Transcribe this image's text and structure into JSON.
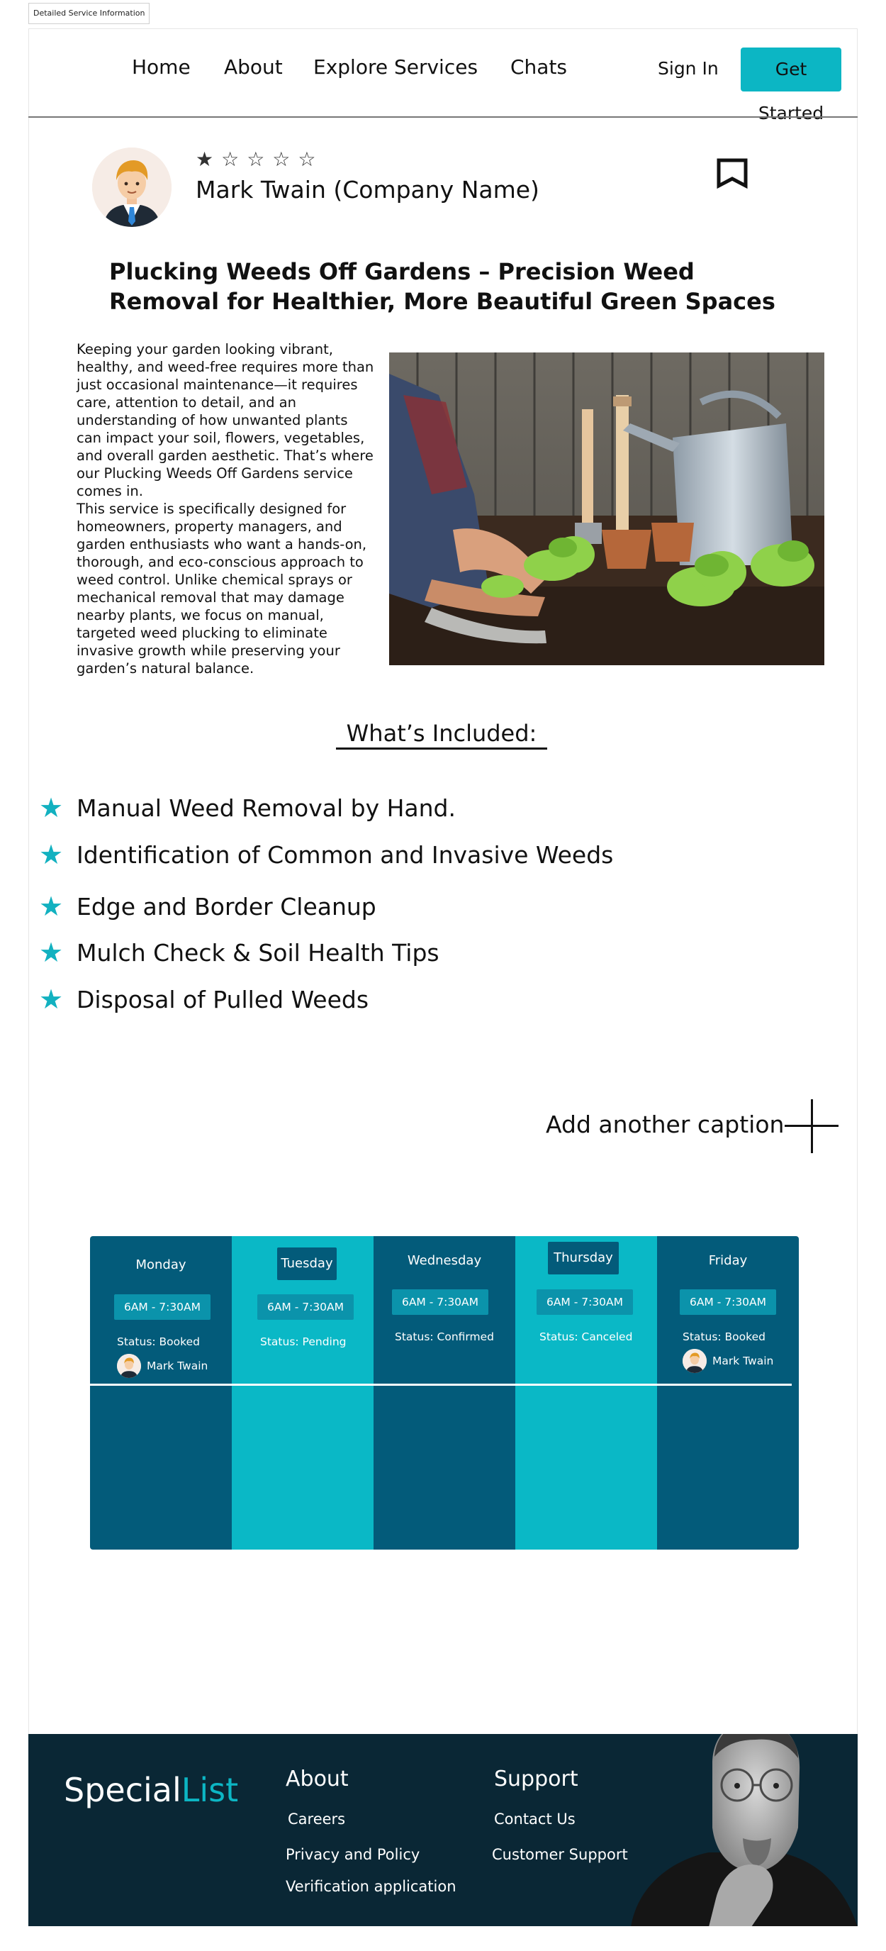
{
  "frame_tag": "Detailed Service Information",
  "nav": {
    "links": [
      "Home",
      "About",
      "Explore Services",
      "Chats"
    ],
    "sign_in": "Sign In",
    "get_started": "Get Started"
  },
  "profile": {
    "stars": "☆☆☆☆☆",
    "rating": 1,
    "rating_max": 5,
    "company": "Mark Twain (Company Name)"
  },
  "service": {
    "title": "Plucking Weeds Off Gardens – Precision Weed Removal for Healthier, More Beautiful Green Spaces",
    "paragraphs": [
      "Keeping your garden looking vibrant, healthy, and weed-free requires more than just occasional maintenance—it requires care, attention to detail, and an understanding of how unwanted plants can impact your soil, flowers, vegetables, and overall garden aesthetic. That’s where our Plucking Weeds Off Gardens service comes in.",
      "This service is specifically designed for homeowners, property managers, and garden enthusiasts who want a hands-on, thorough, and eco-conscious approach to weed control. Unlike chemical sprays or mechanical removal that may damage nearby plants, we focus on manual, targeted weed plucking to eliminate invasive growth while preserving your garden’s natural balance."
    ]
  },
  "included": {
    "title": "What’s Included:",
    "items": [
      "Manual Weed Removal by Hand.",
      "Identification of Common and Invasive Weeds",
      "Edge and Border Cleanup",
      "Mulch Check & Soil Health Tips",
      "Disposal of Pulled Weeds"
    ]
  },
  "caption": "Add another caption",
  "schedule": {
    "days": [
      {
        "day": "Monday",
        "slot": "6AM - 7:30AM",
        "status": "Status: Booked",
        "person": "Mark Twain"
      },
      {
        "day": "Tuesday",
        "slot": "6AM - 7:30AM",
        "status": "Status: Pending"
      },
      {
        "day": "Wednesday",
        "slot": "6AM - 7:30AM",
        "status": "Status: Confirmed"
      },
      {
        "day": "Thursday",
        "slot": "6AM - 7:30AM",
        "status": "Status: Canceled"
      },
      {
        "day": "Friday",
        "slot": "6AM - 7:30AM",
        "status": "Status: Booked",
        "person": "Mark Twain"
      }
    ]
  },
  "footer": {
    "logo_main": "Special",
    "logo_accent": "List",
    "about": {
      "heading": "About",
      "links": [
        "Careers",
        "Privacy and Policy",
        "Verification application"
      ]
    },
    "support": {
      "heading": "Support",
      "links": [
        "Contact Us",
        "Customer Support"
      ]
    }
  },
  "colors": {
    "accent": "#0cb6c4",
    "schedule_dark": "#035b7a",
    "schedule_light": "#0ab8c6",
    "footer_bg": "#0a2735"
  }
}
